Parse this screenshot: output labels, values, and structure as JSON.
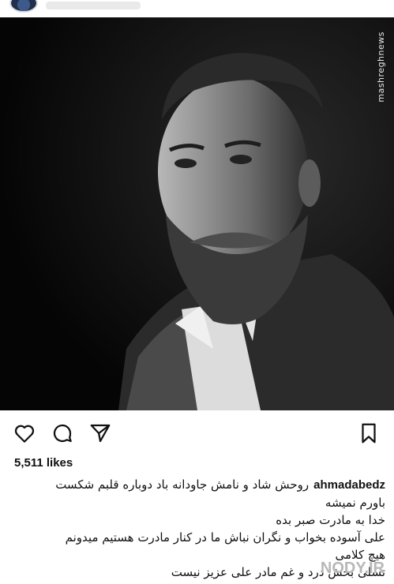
{
  "post": {
    "photo_credit": "mashreghnews",
    "likes": "5,511 likes",
    "author": "ahmadabedz",
    "caption_lines": [
      "روحش شاد و نامش جاودانه باد دوباره قلبم شکست",
      "باورم نمیشه",
      "خدا به مادرت صبر بده",
      "علی آسوده بخواب و نگران نباش ما در کنار مادرت هستیم  میدونم",
      "هیچ کلامی",
      "تسلی بخش درد و غم مادر  علی عزیز نیست"
    ]
  },
  "watermark": "NODY.IR",
  "icons": {
    "like": "heart-icon",
    "comment": "comment-icon",
    "share": "send-icon",
    "save": "bookmark-icon"
  }
}
